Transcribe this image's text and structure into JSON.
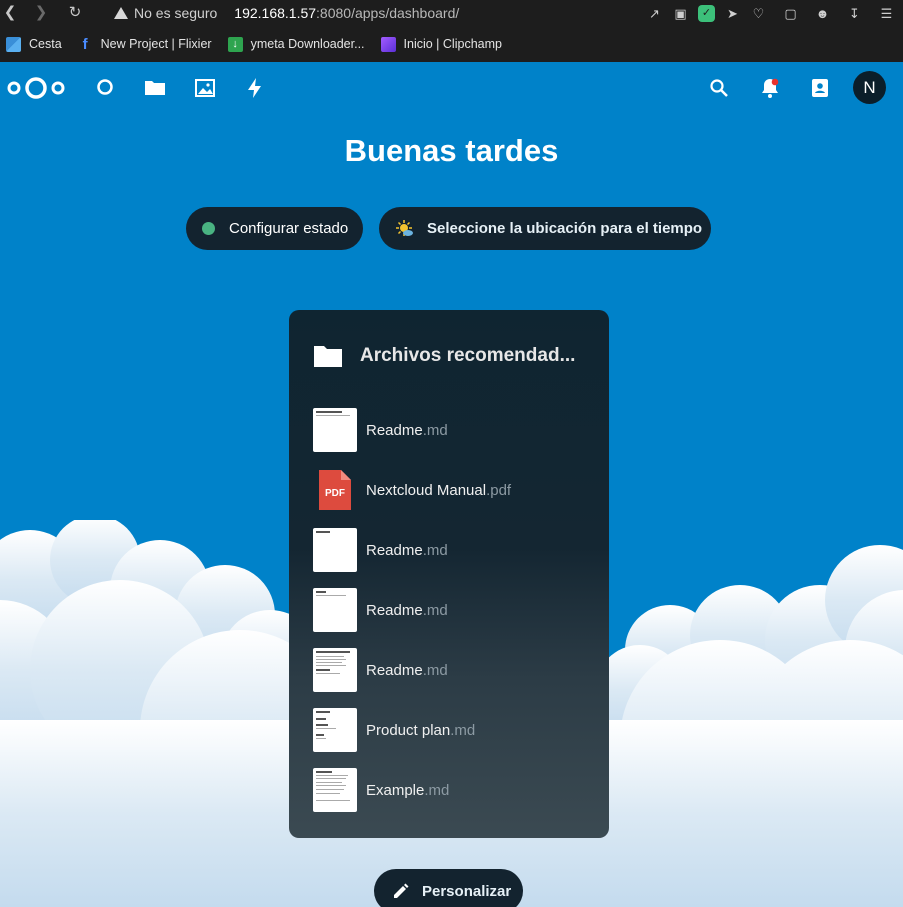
{
  "browser": {
    "security_label": "No es seguro",
    "url_host": "192.168.1.57",
    "url_path": ":8080/apps/dashboard/",
    "bookmarks": [
      {
        "label": "Cesta",
        "icon": "cesta-icon",
        "color": "#3a8fd8"
      },
      {
        "label": "New Project | Flixier",
        "icon": "flixier-icon",
        "color": "#2f6bd6"
      },
      {
        "label": "ymeta Downloader...",
        "icon": "download-icon",
        "color": "#2ea44f"
      },
      {
        "label": "Inicio | Clipchamp",
        "icon": "clipchamp-icon",
        "color": "#7b3fe4"
      }
    ]
  },
  "header": {
    "avatar_initial": "N",
    "apps": [
      "dashboard-icon",
      "files-icon",
      "photos-icon",
      "activity-icon"
    ],
    "right_icons": [
      "search-icon",
      "notifications-icon",
      "contacts-icon"
    ]
  },
  "main": {
    "greeting": "Buenas tardes",
    "status_button": "Configurar estado",
    "weather_button": "Seleccione la ubicación para el tiempo",
    "customize_button": "Personalizar"
  },
  "widget": {
    "title": "Archivos recomendad...",
    "files": [
      {
        "name": "Readme",
        "ext": ".md",
        "type": "md"
      },
      {
        "name": "Nextcloud Manual",
        "ext": ".pdf",
        "type": "pdf"
      },
      {
        "name": "Readme",
        "ext": ".md",
        "type": "md"
      },
      {
        "name": "Readme",
        "ext": ".md",
        "type": "md"
      },
      {
        "name": "Readme",
        "ext": ".md",
        "type": "md"
      },
      {
        "name": "Product plan",
        "ext": ".md",
        "type": "md"
      },
      {
        "name": "Example",
        "ext": ".md",
        "type": "md"
      }
    ]
  },
  "colors": {
    "brand_blue": "#0082c9",
    "dark_pill": "#13232f",
    "status_green": "#49b382",
    "pdf_red": "#dd4b3e"
  }
}
